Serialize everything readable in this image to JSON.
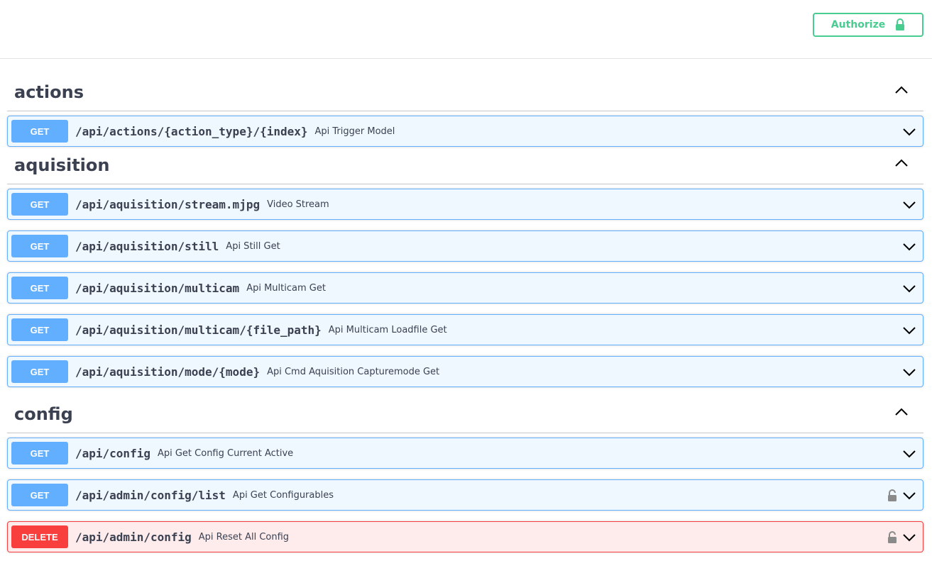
{
  "header": {
    "authorize_label": "Authorize"
  },
  "sections": [
    {
      "title": "actions",
      "operations": [
        {
          "method": "GET",
          "path": "/api/actions/{action_type}/{index}",
          "summary": "Api Trigger Model"
        }
      ]
    },
    {
      "title": "aquisition",
      "operations": [
        {
          "method": "GET",
          "path": "/api/aquisition/stream.mjpg",
          "summary": "Video Stream"
        },
        {
          "method": "GET",
          "path": "/api/aquisition/still",
          "summary": "Api Still Get"
        },
        {
          "method": "GET",
          "path": "/api/aquisition/multicam",
          "summary": "Api Multicam Get"
        },
        {
          "method": "GET",
          "path": "/api/aquisition/multicam/{file_path}",
          "summary": "Api Multicam Loadfile Get"
        },
        {
          "method": "GET",
          "path": "/api/aquisition/mode/{mode}",
          "summary": "Api Cmd Aquisition Capturemode Get"
        }
      ]
    },
    {
      "title": "config",
      "operations": [
        {
          "method": "GET",
          "path": "/api/config",
          "summary": "Api Get Config Current Active"
        },
        {
          "method": "GET",
          "path": "/api/admin/config/list",
          "summary": "Api Get Configurables"
        },
        {
          "method": "DELETE",
          "path": "/api/admin/config",
          "summary": "Api Reset All Config"
        }
      ]
    }
  ],
  "colors": {
    "get": "#61affe",
    "delete": "#f93e3e",
    "authorize": "#49cc90"
  },
  "icons": {
    "authorize": "lock-icon",
    "section_toggle": "chevron-up-icon",
    "operation_toggle": "chevron-down-icon",
    "operation_lock": "unlocked-lock-icon"
  }
}
